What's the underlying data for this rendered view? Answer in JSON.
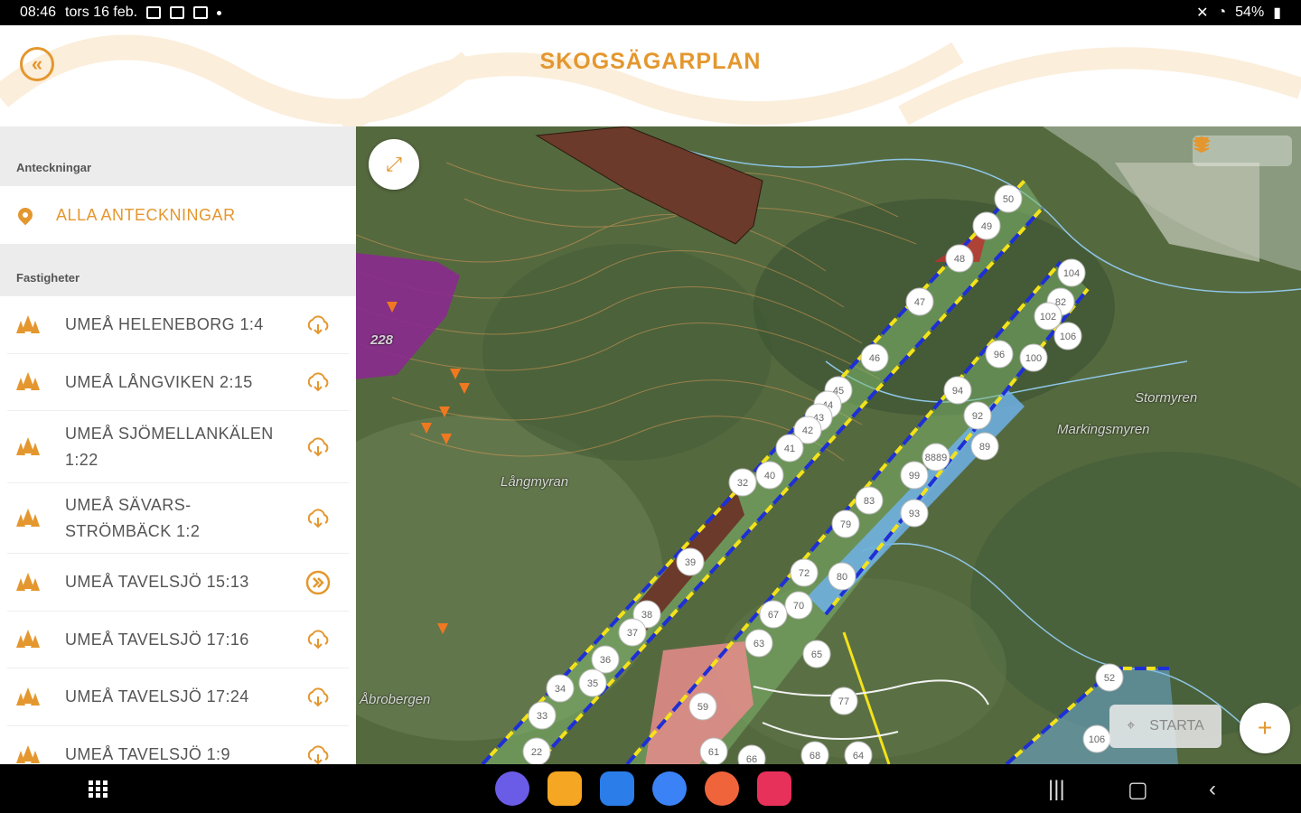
{
  "status_bar": {
    "time": "08:46",
    "date": "tors 16 feb.",
    "battery": "54%"
  },
  "header": {
    "title": "SKOGSÄGARPLAN",
    "back_icon": "double-chevron-left-icon"
  },
  "sidebar": {
    "notes_section": "Anteckningar",
    "all_notes_label": "ALLA ANTECKNINGAR",
    "properties_section": "Fastigheter",
    "properties": [
      {
        "label": "UMEÅ HELENEBORG 1:4",
        "action": "download-cloud-icon"
      },
      {
        "label": "UMEÅ LÅNGVIKEN 2:15",
        "action": "download-cloud-icon"
      },
      {
        "label": "UMEÅ SJÖMELLANKÄLEN 1:22",
        "action": "download-cloud-icon"
      },
      {
        "label": "UMEÅ SÄVARS-STRÖMBÄCK 1:2",
        "action": "download-cloud-icon"
      },
      {
        "label": "UMEÅ TAVELSJÖ 15:13",
        "action": "open-arrow-icon"
      },
      {
        "label": "UMEÅ TAVELSJÖ 17:16",
        "action": "download-cloud-icon"
      },
      {
        "label": "UMEÅ TAVELSJÖ 17:24",
        "action": "download-cloud-icon"
      },
      {
        "label": "UMEÅ TAVELSJÖ 1:9",
        "action": "download-cloud-icon"
      }
    ]
  },
  "map": {
    "place_names": [
      "Långmyran",
      "Stormyren",
      "Markingsmyren",
      "Åbrobergen",
      "228"
    ],
    "stand_numbers": [
      "50",
      "49",
      "48",
      "47",
      "46",
      "45",
      "44",
      "43",
      "42",
      "41",
      "40",
      "32",
      "39",
      "38",
      "37",
      "36",
      "35",
      "34",
      "33",
      "22",
      "104",
      "82",
      "102",
      "106",
      "96",
      "100",
      "94",
      "92",
      "89",
      "8889",
      "99",
      "83",
      "93",
      "79",
      "80",
      "72",
      "70",
      "67",
      "63",
      "65",
      "77",
      "59",
      "61",
      "66",
      "68",
      "64",
      "106",
      "52"
    ],
    "starta_label": "STARTA",
    "fab_label": "+"
  },
  "colors": {
    "accent": "#e4972e",
    "stand_border_blue": "#1e2fd6",
    "stand_border_yellow": "#f4e21a"
  }
}
